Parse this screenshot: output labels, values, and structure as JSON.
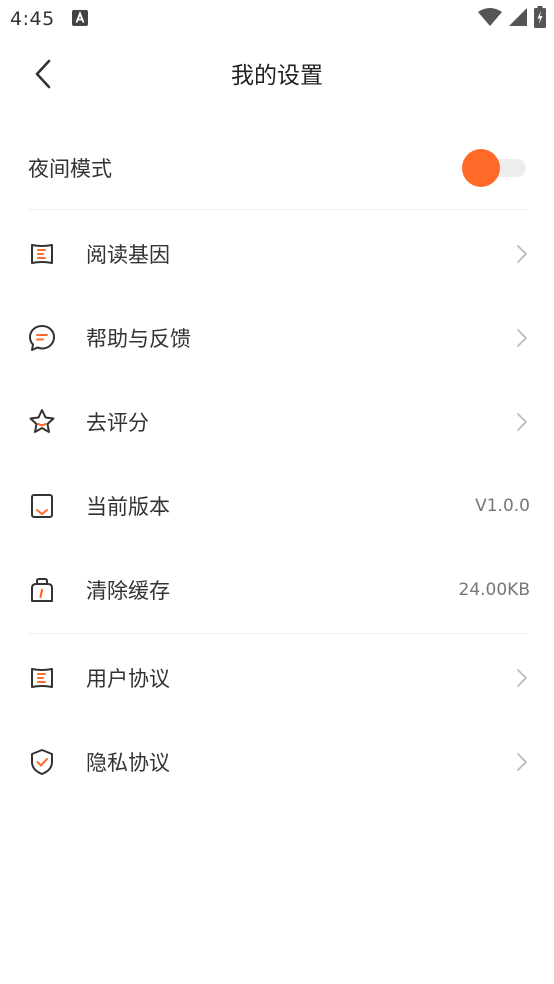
{
  "status_bar": {
    "time": "4:45",
    "notification_icon": "a-icon",
    "wifi_icon": "wifi-icon",
    "signal_icon": "signal-icon",
    "battery_icon": "battery-charging-icon"
  },
  "header": {
    "title": "我的设置",
    "back_icon": "chevron-left-icon"
  },
  "night_mode": {
    "label": "夜间模式",
    "enabled": true
  },
  "menu": {
    "items": [
      {
        "label": "阅读基因",
        "icon": "book-icon",
        "value": ""
      },
      {
        "label": "帮助与反馈",
        "icon": "chat-icon",
        "value": ""
      },
      {
        "label": "去评分",
        "icon": "star-icon",
        "value": ""
      },
      {
        "label": "当前版本",
        "icon": "bookmark-icon",
        "value": "V1.0.0"
      },
      {
        "label": "清除缓存",
        "icon": "cache-icon",
        "value": "24.00KB"
      },
      {
        "label": "用户协议",
        "icon": "book-icon",
        "value": ""
      },
      {
        "label": "隐私协议",
        "icon": "shield-icon",
        "value": ""
      }
    ]
  },
  "colors": {
    "accent": "#ff6a29",
    "icon_stroke": "#333333",
    "chevron": "#bbbbbb"
  }
}
